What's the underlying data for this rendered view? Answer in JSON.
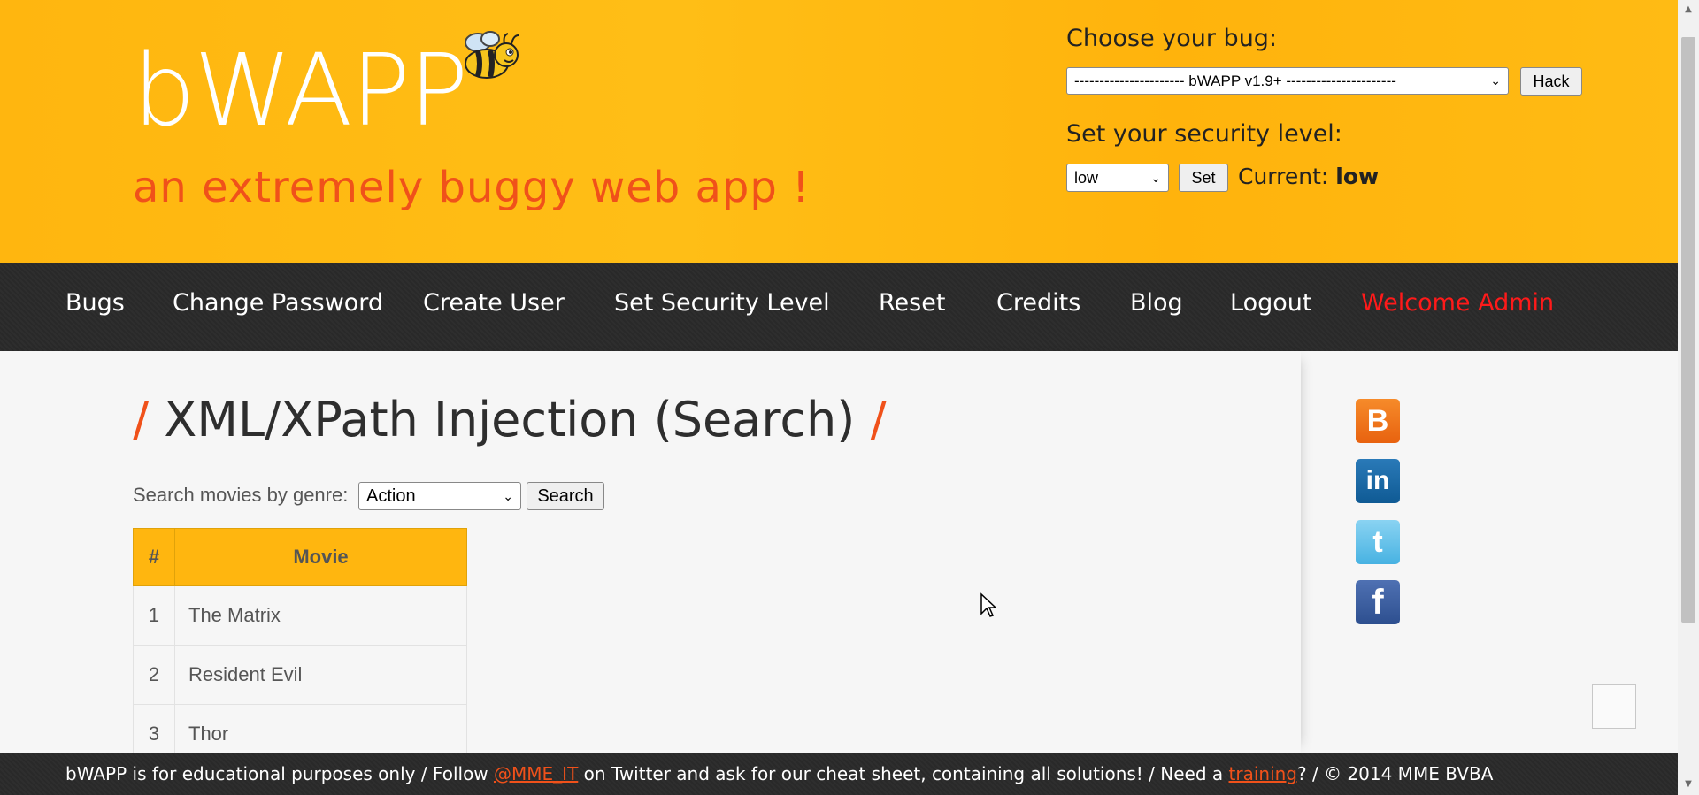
{
  "header": {
    "logo_text": "bWAPP",
    "tagline": "an extremely buggy web app !",
    "choose_bug_label": "Choose your bug:",
    "bug_selected": "---------------------- bWAPP v1.9+ ----------------------",
    "hack_label": "Hack",
    "security_label": "Set your security level:",
    "security_selected": "low",
    "set_label": "Set",
    "current_label": "Current:",
    "current_value": "low"
  },
  "nav": {
    "items": [
      "Bugs",
      "Change Password",
      "Create User",
      "Set Security Level",
      "Reset",
      "Credits",
      "Blog",
      "Logout"
    ],
    "welcome": "Welcome Admin"
  },
  "main": {
    "title": "XML/XPath Injection (Search)",
    "slash": "/",
    "search_label": "Search movies by genre:",
    "genre_selected": "Action",
    "search_button": "Search",
    "table": {
      "headers": [
        "#",
        "Movie"
      ],
      "rows": [
        [
          "1",
          "The Matrix"
        ],
        [
          "2",
          "Resident Evil"
        ],
        [
          "3",
          "Thor"
        ]
      ]
    }
  },
  "social": [
    "blogger-icon",
    "linkedin-icon",
    "twitter-icon",
    "facebook-icon"
  ],
  "footer": {
    "part1": "bWAPP is for educational purposes only / Follow ",
    "twitter_link": "@MME_IT",
    "part2": " on Twitter and ask for our cheat sheet, containing all solutions! / Need a ",
    "training_link": "training",
    "part3": "? / © 2014 MME BVBA"
  },
  "colors": {
    "header_bg": "#ffb60f",
    "accent": "#f0511a",
    "nav_bg": "#2c2c2c",
    "welcome": "#ff1a1a"
  }
}
